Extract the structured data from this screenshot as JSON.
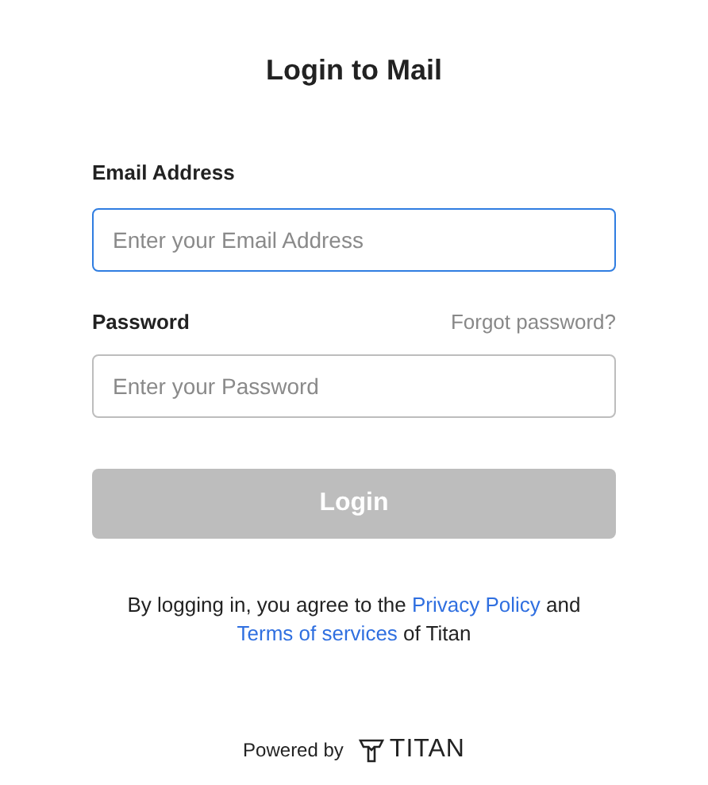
{
  "title": "Login to Mail",
  "email": {
    "label": "Email Address",
    "placeholder": "Enter your Email Address",
    "focused": true
  },
  "password": {
    "label": "Password",
    "forgot_link": "Forgot password?",
    "placeholder": "Enter your Password",
    "focused": false
  },
  "login_button": {
    "label": "Login",
    "disabled": true
  },
  "agreement": [
    {
      "kind": "text",
      "text": "By logging in, you agree to the "
    },
    {
      "kind": "link",
      "text": "Privacy Policy"
    },
    {
      "kind": "text",
      "text": " and "
    },
    {
      "kind": "link",
      "text": "Terms of services"
    },
    {
      "kind": "text",
      "text": " of Titan"
    }
  ],
  "footer": {
    "powered_by": "Powered by",
    "brand": "TITAN"
  }
}
